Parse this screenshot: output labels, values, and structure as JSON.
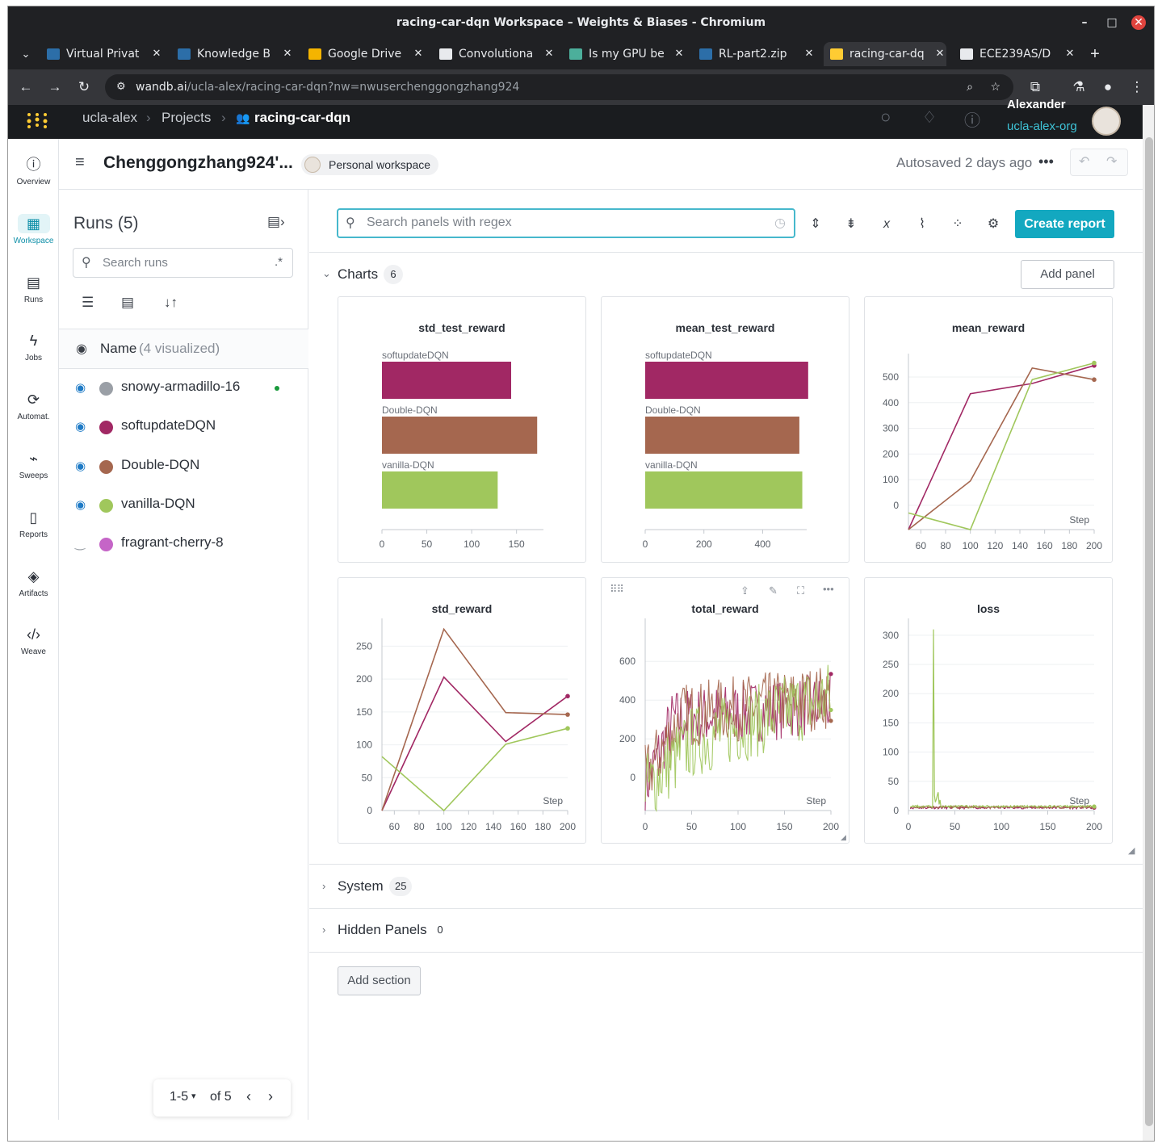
{
  "window": {
    "title": "racing-car-dqn Workspace – Weights & Biases - Chromium"
  },
  "tabs": [
    {
      "label": "Virtual Privat",
      "icon": "ucla-icon"
    },
    {
      "label": "Knowledge B",
      "icon": "ucla-icon"
    },
    {
      "label": "Google Drive",
      "icon": "google-drive-icon"
    },
    {
      "label": "Convolutiona",
      "icon": "openai-icon"
    },
    {
      "label": "Is my GPU be",
      "icon": "page-icon"
    },
    {
      "label": "RL-part2.zip",
      "icon": "ucla-icon"
    },
    {
      "label": "racing-car-dq",
      "icon": "wandb-icon"
    },
    {
      "label": "ECE239AS/D",
      "icon": "github-icon"
    }
  ],
  "address": {
    "domain": "wandb.ai",
    "path": "/ucla-alex/racing-car-dqn?nw=nwuserchenggongzhang924"
  },
  "header": {
    "org": "ucla-alex",
    "projects": "Projects",
    "project": "racing-car-dqn",
    "user_name": "Alexander",
    "user_org": "ucla-alex-org"
  },
  "leftnav": [
    {
      "label": "Overview",
      "icon": "info-icon"
    },
    {
      "label": "Workspace",
      "icon": "workspace-icon"
    },
    {
      "label": "Runs",
      "icon": "table-icon"
    },
    {
      "label": "Jobs",
      "icon": "bolt-icon"
    },
    {
      "label": "Automat.",
      "icon": "automation-icon"
    },
    {
      "label": "Sweeps",
      "icon": "broom-icon"
    },
    {
      "label": "Reports",
      "icon": "clipboard-icon"
    },
    {
      "label": "Artifacts",
      "icon": "layers-icon"
    },
    {
      "label": "Weave",
      "icon": "code-icon"
    }
  ],
  "workspace": {
    "title": "Chenggongzhang924'...",
    "badge": "Personal workspace",
    "autosave": "Autosaved 2 days ago"
  },
  "runs": {
    "title": "Runs (5)",
    "search_placeholder": "Search runs",
    "regex": ".*",
    "name_header": "Name",
    "visualized": "(4 visualized)",
    "items": [
      {
        "name": "snowy-armadillo-16",
        "color": "#9a9fa6",
        "visible": true,
        "running": true
      },
      {
        "name": "softupdateDQN",
        "color": "#a12864",
        "visible": true,
        "running": false
      },
      {
        "name": "Double-DQN",
        "color": "#a5674f",
        "visible": true,
        "running": false
      },
      {
        "name": "vanilla-DQN",
        "color": "#a0c75c",
        "visible": true,
        "running": false
      },
      {
        "name": "fragrant-cherry-8",
        "color": "#c565c7",
        "visible": false,
        "running": false
      }
    ],
    "pagination": {
      "range": "1-5",
      "of": "of 5"
    }
  },
  "toolbar": {
    "search_placeholder": "Search panels with regex",
    "create_report": "Create report"
  },
  "sections": {
    "charts": {
      "label": "Charts",
      "count": "6",
      "add_panel": "Add panel"
    },
    "system": {
      "label": "System",
      "count": "25"
    },
    "hidden": {
      "label": "Hidden Panels",
      "count": "0"
    },
    "add_section": "Add section"
  },
  "colors": {
    "softupdateDQN": "#a12864",
    "Double-DQN": "#a5674f",
    "vanilla-DQN": "#a0c75c",
    "accent": "#13a8c0"
  },
  "chart_data": [
    {
      "type": "bar",
      "title": "std_test_reward",
      "categories": [
        "softupdateDQN",
        "Double-DQN",
        "vanilla-DQN"
      ],
      "values": [
        144,
        173,
        129
      ],
      "xlim": [
        0,
        180
      ],
      "xticks": [
        0,
        50,
        100,
        150
      ]
    },
    {
      "type": "bar",
      "title": "mean_test_reward",
      "categories": [
        "softupdateDQN",
        "Double-DQN",
        "vanilla-DQN"
      ],
      "values": [
        555,
        525,
        535
      ],
      "xlim": [
        0,
        550
      ],
      "xticks": [
        0,
        200,
        400
      ]
    },
    {
      "type": "line",
      "title": "mean_reward",
      "xlabel": "Step",
      "xlim": [
        50,
        200
      ],
      "ylim": [
        -95,
        560
      ],
      "xticks": [
        60,
        80,
        100,
        120,
        140,
        160,
        180,
        200
      ],
      "yticks": [
        0,
        100,
        200,
        300,
        400,
        500
      ],
      "series": [
        {
          "name": "softupdateDQN",
          "x": [
            50,
            100,
            150,
            200
          ],
          "y": [
            -95,
            435,
            475,
            545
          ]
        },
        {
          "name": "Double-DQN",
          "x": [
            50,
            100,
            150,
            200
          ],
          "y": [
            -95,
            95,
            535,
            490
          ]
        },
        {
          "name": "vanilla-DQN",
          "x": [
            50,
            100,
            150,
            200
          ],
          "y": [
            -30,
            -95,
            490,
            555
          ]
        }
      ]
    },
    {
      "type": "line",
      "title": "std_reward",
      "xlabel": "Step",
      "xlim": [
        50,
        200
      ],
      "ylim": [
        0,
        280
      ],
      "xticks": [
        60,
        80,
        100,
        120,
        140,
        160,
        180,
        200
      ],
      "yticks": [
        0,
        50,
        100,
        150,
        200,
        250
      ],
      "series": [
        {
          "name": "softupdateDQN",
          "x": [
            50,
            100,
            150,
            200
          ],
          "y": [
            0,
            203,
            105,
            174
          ]
        },
        {
          "name": "Double-DQN",
          "x": [
            50,
            100,
            150,
            200
          ],
          "y": [
            0,
            276,
            149,
            146
          ]
        },
        {
          "name": "vanilla-DQN",
          "x": [
            50,
            100,
            150,
            200
          ],
          "y": [
            82,
            0,
            101,
            125
          ]
        }
      ]
    },
    {
      "type": "line",
      "title": "total_reward",
      "xlabel": "Step",
      "xlim": [
        0,
        200
      ],
      "ylim": [
        -170,
        780
      ],
      "xticks": [
        0,
        50,
        100,
        150,
        200
      ],
      "yticks": [
        0,
        200,
        400,
        600
      ],
      "seed": 7,
      "series": [
        {
          "name": "softupdateDQN",
          "trend": [
            [
              0,
              -50
            ],
            [
              30,
              300
            ],
            [
              200,
              380
            ]
          ],
          "noise": 160
        },
        {
          "name": "Double-DQN",
          "trend": [
            [
              0,
              0
            ],
            [
              40,
              320
            ],
            [
              200,
              420
            ]
          ],
          "noise": 170
        },
        {
          "name": "vanilla-DQN",
          "trend": [
            [
              0,
              -60
            ],
            [
              50,
              180
            ],
            [
              200,
              420
            ]
          ],
          "noise": 190
        }
      ]
    },
    {
      "type": "line",
      "title": "loss",
      "xlabel": "Step",
      "xlim": [
        0,
        200
      ],
      "ylim": [
        0,
        315
      ],
      "xticks": [
        0,
        50,
        100,
        150,
        200
      ],
      "yticks": [
        0,
        50,
        100,
        150,
        200,
        250,
        300
      ],
      "series": [
        {
          "name": "softupdateDQN",
          "base": 3
        },
        {
          "name": "Double-DQN",
          "base": 4
        },
        {
          "name": "vanilla-DQN",
          "base": 5,
          "spike": {
            "x": 27,
            "y": 310
          }
        }
      ]
    }
  ]
}
